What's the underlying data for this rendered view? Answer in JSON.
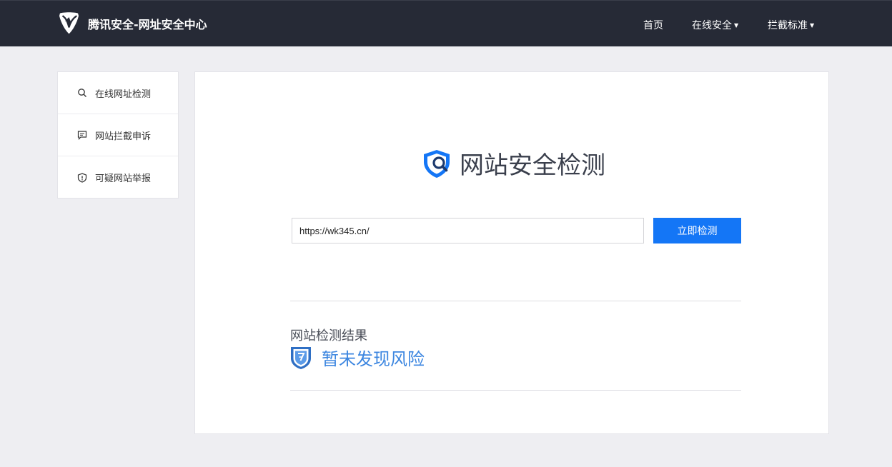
{
  "header": {
    "brand_title": "腾讯安全-网址安全中心",
    "nav": {
      "home": "首页",
      "online_security": "在线安全",
      "intercept_standard": "拦截标准"
    }
  },
  "sidebar": {
    "items": [
      {
        "label": "在线网址检测",
        "icon": "search-icon"
      },
      {
        "label": "网站拦截申诉",
        "icon": "message-icon"
      },
      {
        "label": "可疑网站举报",
        "icon": "shield-alert-icon"
      }
    ]
  },
  "main": {
    "title": "网站安全检测",
    "url_value": "https://wk345.cn/",
    "check_button": "立即检测",
    "result_label": "网站检测结果",
    "result_text": "暂未发现风险"
  },
  "colors": {
    "topbar": "#262a36",
    "accent_blue": "#1476f6",
    "result_blue": "#3c86e0"
  }
}
